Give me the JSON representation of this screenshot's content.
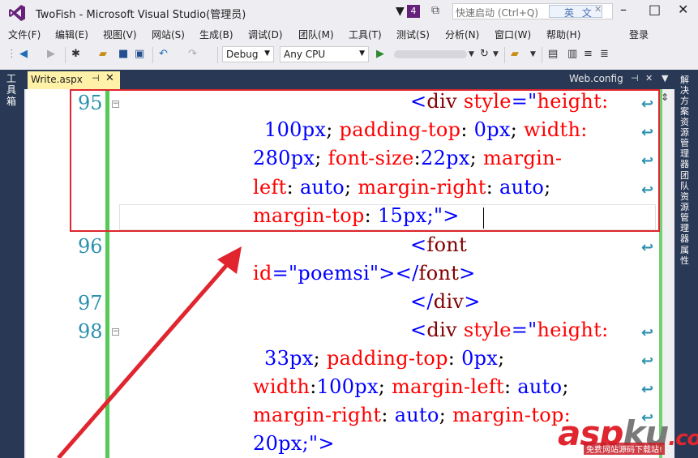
{
  "title_bar": {
    "title": "TwoFish - Microsoft Visual Studio(管理员)",
    "notification_count": "4",
    "quick_launch_placeholder": "快速启动 (Ctrl+Q)",
    "ime_label": "英 文"
  },
  "menu": {
    "items": [
      "文件(F)",
      "编辑(E)",
      "视图(V)",
      "网站(S)",
      "生成(B)",
      "调试(D)",
      "团队(M)",
      "工具(T)",
      "测试(S)",
      "分析(N)",
      "窗口(W)",
      "帮助(H)"
    ],
    "login": "登录"
  },
  "toolbar": {
    "config": "Debug",
    "platform": "Any CPU"
  },
  "left_strip": {
    "label": "工具箱"
  },
  "right_strip": {
    "labels": [
      "解决方案资源管理器",
      "团队资源管理器",
      "属性"
    ]
  },
  "tabs": {
    "active": "Write.aspx",
    "secondary": "Web.config"
  },
  "editor": {
    "line_numbers": [
      "95",
      "96",
      "97",
      "98"
    ],
    "lines": [
      [
        {
          "t": "<",
          "c": "blue"
        },
        {
          "t": "div",
          "c": "tag"
        },
        {
          "t": " style",
          "c": "attr"
        },
        {
          "t": "=\"",
          "c": "blue"
        },
        {
          "t": "height:",
          "c": "attr"
        }
      ],
      [
        {
          "t": "100px",
          "c": "str"
        },
        {
          "t": "; ",
          "c": "plain"
        },
        {
          "t": "padding-top",
          "c": "attr"
        },
        {
          "t": ": ",
          "c": "plain"
        },
        {
          "t": "0px",
          "c": "str"
        },
        {
          "t": "; ",
          "c": "plain"
        },
        {
          "t": "width:",
          "c": "attr"
        }
      ],
      [
        {
          "t": "280px",
          "c": "str"
        },
        {
          "t": "; ",
          "c": "plain"
        },
        {
          "t": "font-size",
          "c": "attr"
        },
        {
          "t": ":",
          "c": "plain"
        },
        {
          "t": "22px",
          "c": "str"
        },
        {
          "t": "; ",
          "c": "plain"
        },
        {
          "t": "margin-",
          "c": "attr"
        }
      ],
      [
        {
          "t": "left",
          "c": "attr"
        },
        {
          "t": ": ",
          "c": "plain"
        },
        {
          "t": "auto",
          "c": "str"
        },
        {
          "t": "; ",
          "c": "plain"
        },
        {
          "t": "margin-right",
          "c": "attr"
        },
        {
          "t": ": ",
          "c": "plain"
        },
        {
          "t": "auto",
          "c": "str"
        },
        {
          "t": ";",
          "c": "plain"
        }
      ],
      [
        {
          "t": "margin-top",
          "c": "attr"
        },
        {
          "t": ": ",
          "c": "plain"
        },
        {
          "t": "15px",
          "c": "str"
        },
        {
          "t": ";\">",
          "c": "blue"
        }
      ],
      [
        {
          "t": "<",
          "c": "blue"
        },
        {
          "t": "font",
          "c": "tag"
        }
      ],
      [
        {
          "t": "id",
          "c": "attr"
        },
        {
          "t": "=\"poemsi\"",
          "c": "blue"
        },
        {
          "t": "></",
          "c": "blue"
        },
        {
          "t": "font",
          "c": "tag"
        },
        {
          "t": ">",
          "c": "blue"
        }
      ],
      [
        {
          "t": "</",
          "c": "blue"
        },
        {
          "t": "div",
          "c": "tag"
        },
        {
          "t": ">",
          "c": "blue"
        }
      ],
      [
        {
          "t": "<",
          "c": "blue"
        },
        {
          "t": "div",
          "c": "tag"
        },
        {
          "t": " style",
          "c": "attr"
        },
        {
          "t": "=\"",
          "c": "blue"
        },
        {
          "t": "height:",
          "c": "attr"
        }
      ],
      [
        {
          "t": "33px",
          "c": "str"
        },
        {
          "t": "; ",
          "c": "plain"
        },
        {
          "t": "padding-top",
          "c": "attr"
        },
        {
          "t": ": ",
          "c": "plain"
        },
        {
          "t": "0px",
          "c": "str"
        },
        {
          "t": ";",
          "c": "plain"
        }
      ],
      [
        {
          "t": "width",
          "c": "attr"
        },
        {
          "t": ":",
          "c": "plain"
        },
        {
          "t": "100px",
          "c": "str"
        },
        {
          "t": "; ",
          "c": "plain"
        },
        {
          "t": "margin-left",
          "c": "attr"
        },
        {
          "t": ": ",
          "c": "plain"
        },
        {
          "t": "auto",
          "c": "str"
        },
        {
          "t": ";",
          "c": "plain"
        }
      ],
      [
        {
          "t": "margin-right",
          "c": "attr"
        },
        {
          "t": ": ",
          "c": "plain"
        },
        {
          "t": "auto",
          "c": "str"
        },
        {
          "t": "; ",
          "c": "plain"
        },
        {
          "t": "margin-top:",
          "c": "attr"
        }
      ],
      [
        {
          "t": "20px",
          "c": "str"
        },
        {
          "t": ";\">",
          "c": "blue"
        }
      ]
    ]
  },
  "watermark": {
    "brand_a": "asp",
    "brand_b": "ku",
    "brand_c": ".com",
    "tagline": "免费网站源码下载站!"
  },
  "colors": {
    "vs_purple": "#68217a",
    "tag": "#800000",
    "attr": "#ff0000",
    "string": "#0000ff",
    "line_number": "#2b91af",
    "highlight_box": "#e0252e",
    "active_tab": "#fff1a8"
  }
}
